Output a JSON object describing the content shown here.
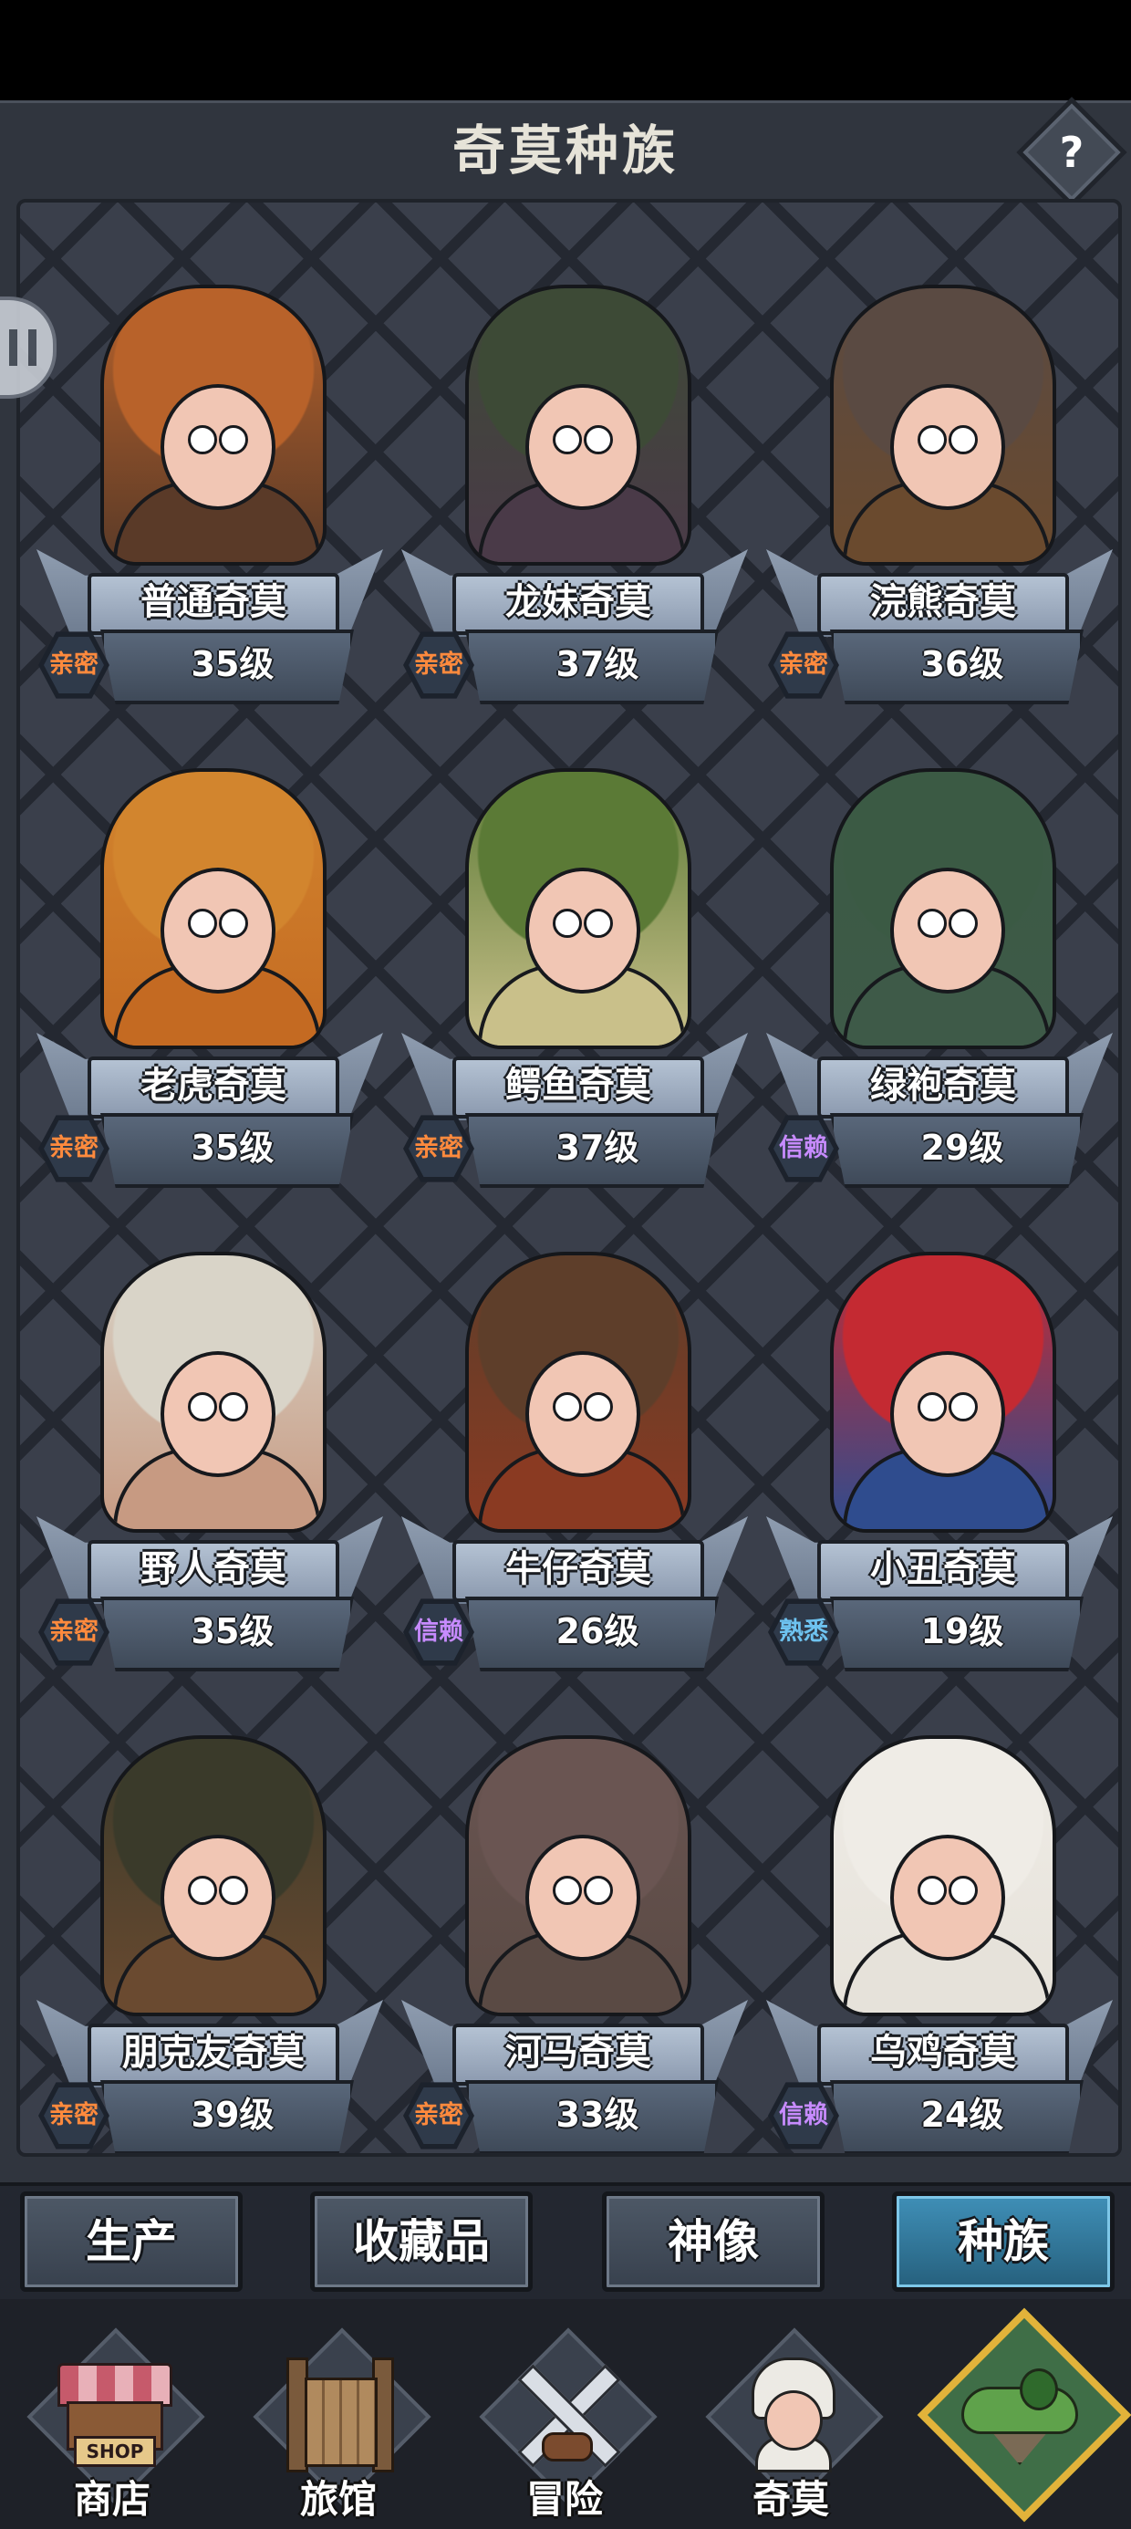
{
  "header": {
    "title": "奇莫种族",
    "help_label": "?"
  },
  "relationship_colors": {
    "亲密": "#ff8a3d",
    "信赖": "#c78bff",
    "熟悉": "#6ec3f0"
  },
  "races": [
    {
      "name": "普通奇莫",
      "level": "35级",
      "relation": "亲密",
      "rel_color": "#ff8a3d",
      "outfit": "pumpkin-hat",
      "hat_color": "#b8622a",
      "body_color": "#5a3a28"
    },
    {
      "name": "龙妹奇莫",
      "level": "37级",
      "relation": "亲密",
      "rel_color": "#ff8a3d",
      "outfit": "dragon-hood",
      "hat_color": "#3d4a36",
      "body_color": "#4a3a48"
    },
    {
      "name": "浣熊奇莫",
      "level": "36级",
      "relation": "亲密",
      "rel_color": "#ff8a3d",
      "outfit": "raccoon-hood",
      "hat_color": "#5a4a42",
      "body_color": "#6a4a2e"
    },
    {
      "name": "老虎奇莫",
      "level": "35级",
      "relation": "亲密",
      "rel_color": "#ff8a3d",
      "outfit": "tiger-hood",
      "hat_color": "#d2852e",
      "body_color": "#c46a22"
    },
    {
      "name": "鳄鱼奇莫",
      "level": "37级",
      "relation": "亲密",
      "rel_color": "#ff8a3d",
      "outfit": "crocodile-hood",
      "hat_color": "#5b7a36",
      "body_color": "#c9c08a"
    },
    {
      "name": "绿袍奇莫",
      "level": "29级",
      "relation": "信赖",
      "rel_color": "#c78bff",
      "outfit": "green-robe",
      "hat_color": "#3b5a44",
      "body_color": "#3e5a48"
    },
    {
      "name": "野人奇莫",
      "level": "35级",
      "relation": "亲密",
      "rel_color": "#ff8a3d",
      "outfit": "skull-helmet",
      "hat_color": "#d9d4c8",
      "body_color": "#c79a82"
    },
    {
      "name": "牛仔奇莫",
      "level": "26级",
      "relation": "信赖",
      "rel_color": "#c78bff",
      "outfit": "cowboy-hat",
      "hat_color": "#5e3e2a",
      "body_color": "#8a3a22"
    },
    {
      "name": "小丑奇莫",
      "level": "19级",
      "relation": "熟悉",
      "rel_color": "#6ec3f0",
      "outfit": "jester-hat",
      "hat_color": "#c42a32",
      "body_color": "#2f4c8e"
    },
    {
      "name": "朋克友奇莫",
      "level": "39级",
      "relation": "亲密",
      "rel_color": "#ff8a3d",
      "outfit": "goggles-scarf",
      "hat_color": "#3a3a2a",
      "body_color": "#6a4a30"
    },
    {
      "name": "河马奇莫",
      "level": "33级",
      "relation": "亲密",
      "rel_color": "#ff8a3d",
      "outfit": "hippo-hood",
      "hat_color": "#6a5552",
      "body_color": "#5a4a44"
    },
    {
      "name": "乌鸡奇莫",
      "level": "24级",
      "relation": "信赖",
      "rel_color": "#c78bff",
      "outfit": "chicken-hood",
      "hat_color": "#efece6",
      "body_color": "#e6e2da"
    }
  ],
  "tabs": [
    {
      "label": "生产",
      "active": false
    },
    {
      "label": "收藏品",
      "active": false
    },
    {
      "label": "神像",
      "active": false
    },
    {
      "label": "种族",
      "active": true
    }
  ],
  "nav": [
    {
      "label": "商店",
      "icon": "shop-icon",
      "sign": "SHOP"
    },
    {
      "label": "旅馆",
      "icon": "inn-gate-icon"
    },
    {
      "label": "冒险",
      "icon": "crossed-swords-icon"
    },
    {
      "label": "奇莫",
      "icon": "kimo-character-icon"
    },
    {
      "label": "",
      "icon": "floating-island-icon",
      "active": true
    }
  ]
}
